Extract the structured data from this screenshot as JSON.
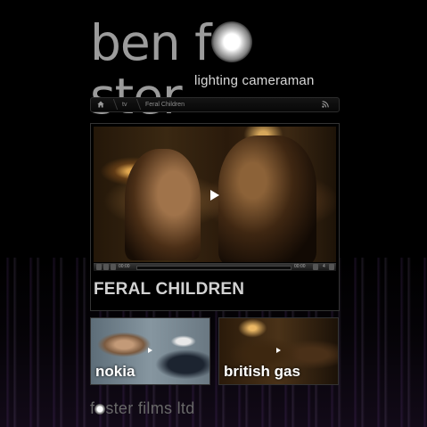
{
  "brand": {
    "logo_before": "ben f",
    "logo_after": "ster",
    "tagline": "lighting cameraman"
  },
  "breadcrumb": {
    "items": [
      "tv",
      "Feral Children"
    ]
  },
  "player": {
    "elapsed": "00:00",
    "duration": "00:00",
    "volume": "4"
  },
  "video_title": "FERAL CHILDREN",
  "thumbnails": [
    {
      "label": "nokia"
    },
    {
      "label": "british gas"
    }
  ],
  "footer": {
    "logo_before": "f",
    "logo_after": "ster films ltd"
  },
  "icons": {
    "home": "home-icon",
    "rss": "rss-icon",
    "play": "play-icon",
    "pause": "pause-icon",
    "stop": "stop-icon",
    "fullscreen": "fullscreen-icon",
    "volume": "volume-icon"
  }
}
